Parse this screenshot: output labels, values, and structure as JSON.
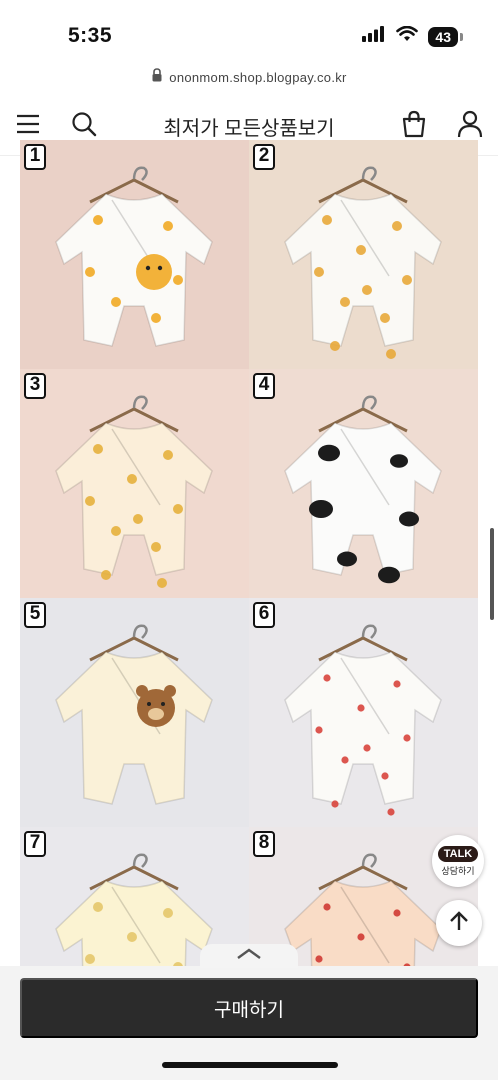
{
  "status_bar": {
    "time": "5:35",
    "battery": "43",
    "icons": [
      "signal-icon",
      "wifi-icon",
      "battery-icon"
    ]
  },
  "browser": {
    "url": "ononmom.shop.blogpay.co.kr",
    "lock_icon": "lock-icon"
  },
  "header": {
    "title": "최저가 모든상품보기",
    "icons": [
      "menu-icon",
      "search-icon",
      "shopping-bag-icon",
      "user-icon"
    ]
  },
  "products": [
    {
      "number": "1",
      "bg": "#ead1c7",
      "body": "#fbfaf7",
      "pattern": "tiger-big",
      "accent": "#f2b23a"
    },
    {
      "number": "2",
      "bg": "#ecdccd",
      "body": "#faf9f5",
      "pattern": "tiger",
      "accent": "#e8a93a"
    },
    {
      "number": "3",
      "bg": "#f0d9cf",
      "body": "#fbeed9",
      "pattern": "chick",
      "accent": "#e6b03c"
    },
    {
      "number": "4",
      "bg": "#efdcd2",
      "body": "#fbfbfa",
      "pattern": "cow",
      "accent": "#1c1c1c"
    },
    {
      "number": "5",
      "bg": "#e6e6ea",
      "body": "#faf1d8",
      "pattern": "bear",
      "accent": "#a06838"
    },
    {
      "number": "6",
      "bg": "#eae8eb",
      "body": "#fbfaf7",
      "pattern": "strawberry",
      "accent": "#d8443c"
    },
    {
      "number": "7",
      "bg": "#e9e8ec",
      "body": "#fbf3d2",
      "pattern": "flower",
      "accent": "#e4c66a"
    },
    {
      "number": "8",
      "bg": "#ece7e8",
      "body": "#f9dcc6",
      "pattern": "cherry",
      "accent": "#cf3a33"
    }
  ],
  "floating": {
    "kakao_talk": "TALK",
    "kakao_label": "상담하기",
    "top_icon": "arrow-up-icon"
  },
  "bottom": {
    "collapse_icon": "chevron-up-icon",
    "buy_label": "구매하기"
  }
}
